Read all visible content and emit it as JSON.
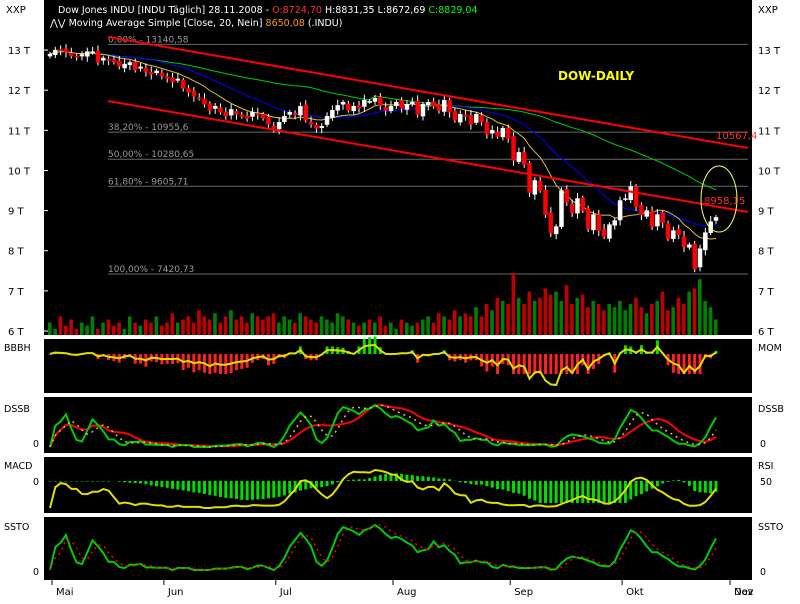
{
  "header": {
    "corner_left": "XXP",
    "corner_right": "XXP",
    "title_prefix": "Dow Jones INDU [INDU  Täglich] 28.11.2008 - ",
    "open_label": "O:8724,70",
    "high_low_label": " H:8831,35 L:8672,69 ",
    "close_label": "C:8829,04",
    "ma_legend_prefix": "Moving Average Simple [Close, 20, Nein] ",
    "ma_value": "8650,08",
    "ma_suffix": " (.INDU)"
  },
  "annotations": {
    "chart_title": "DOW-DAILY",
    "upper_channel_value": "10567,4",
    "lower_channel_value": "8958,15"
  },
  "fibonacci": [
    {
      "label": "0,00% - 13140,58",
      "value": 13140.58
    },
    {
      "label": "38,20% - 10955,6",
      "value": 10955.6
    },
    {
      "label": "50,00% - 10280,65",
      "value": 10280.65
    },
    {
      "label": "61,80% - 9605,71",
      "value": 9605.71
    },
    {
      "label": "100,00% - 7420,73",
      "value": 7420.73
    }
  ],
  "colors": {
    "background": "#000000",
    "up_candle": "#ffffff",
    "down_candle": "#ff0000",
    "ma20": "#e0c040",
    "ma50": "#0000ff",
    "ma200": "#00cc00",
    "trend_lines": "#ff0000",
    "title_text": "#ffff00",
    "volume_up": "#008000",
    "volume_down": "#c00000"
  },
  "panels": [
    {
      "label_left": "BBBH",
      "label_right": "MOM",
      "tick": ""
    },
    {
      "label_left": "DSSB",
      "label_right": "DSSB",
      "tick": "0"
    },
    {
      "label_left": "MACD",
      "label_right": "RSI",
      "tick_left": "0",
      "tick_right": "50"
    },
    {
      "label_left": "SSTO",
      "label_right": "SSTO",
      "tick": "0"
    }
  ],
  "chart_data": {
    "type": "candlestick",
    "title": "DOW-DAILY",
    "y_axis_ticks": [
      {
        "label": "13 T",
        "value": 13000
      },
      {
        "label": "12 T",
        "value": 12000
      },
      {
        "label": "11 T",
        "value": 11000
      },
      {
        "label": "10 T",
        "value": 10000
      },
      {
        "label": "9 T",
        "value": 9000
      },
      {
        "label": "8 T",
        "value": 8000
      },
      {
        "label": "7 T",
        "value": 7000
      },
      {
        "label": "6 T",
        "value": 6000
      }
    ],
    "ylim": [
      5900,
      13500
    ],
    "x_axis_months": [
      "Mai",
      "Jun",
      "Jul",
      "Aug",
      "Sep",
      "Okt",
      "Nov",
      "Dez"
    ],
    "closes": [
      12900,
      13000,
      12980,
      12950,
      12850,
      12820,
      12890,
      12960,
      12960,
      12700,
      12800,
      12760,
      12700,
      12600,
      12650,
      12690,
      12500,
      12580,
      12450,
      12400,
      12480,
      12350,
      12300,
      12200,
      12280,
      12050,
      11950,
      11850,
      11800,
      11650,
      11500,
      11600,
      11450,
      11350,
      11520,
      11400,
      11350,
      11300,
      11450,
      11400,
      11300,
      11150,
      11050,
      11200,
      11350,
      11450,
      11380,
      11600,
      11250,
      11150,
      11050,
      11100,
      11350,
      11500,
      11620,
      11700,
      11500,
      11600,
      11550,
      11750,
      11720,
      11800,
      11620,
      11500,
      11600,
      11700,
      11550,
      11650,
      11700,
      11400,
      11650,
      11700,
      11600,
      11500,
      11750,
      11450,
      11250,
      11400,
      11350,
      11150,
      11400,
      11200,
      10900,
      11000,
      10850,
      11050,
      10800,
      10250,
      10450,
      10150,
      9450,
      9750,
      9500,
      8900,
      8450,
      8600,
      9500,
      9200,
      8950,
      9300,
      9000,
      8550,
      8900,
      8500,
      8350,
      8650,
      8750,
      9250,
      9300,
      9600,
      9100,
      8900,
      9000,
      8600,
      8900,
      8700,
      8300,
      8500,
      8400,
      8100,
      8150,
      7550,
      8050,
      8450,
      8724,
      8829
    ],
    "volume_relative": [
      0.2,
      0.1,
      0.3,
      0.15,
      0.25,
      0.1,
      0.2,
      0.15,
      0.3,
      0.1,
      0.2,
      0.25,
      0.15,
      0.2,
      0.1,
      0.3,
      0.2,
      0.15,
      0.25,
      0.2,
      0.3,
      0.15,
      0.2,
      0.35,
      0.2,
      0.25,
      0.3,
      0.2,
      0.4,
      0.3,
      0.25,
      0.35,
      0.2,
      0.3,
      0.4,
      0.25,
      0.3,
      0.2,
      0.35,
      0.3,
      0.25,
      0.3,
      0.35,
      0.2,
      0.3,
      0.25,
      0.2,
      0.35,
      0.3,
      0.25,
      0.2,
      0.3,
      0.25,
      0.2,
      0.35,
      0.3,
      0.25,
      0.2,
      0.15,
      0.2,
      0.25,
      0.2,
      0.3,
      0.15,
      0.2,
      0.1,
      0.25,
      0.2,
      0.15,
      0.2,
      0.25,
      0.3,
      0.2,
      0.35,
      0.3,
      0.25,
      0.4,
      0.3,
      0.35,
      0.3,
      0.45,
      0.3,
      0.5,
      0.4,
      0.6,
      0.55,
      0.5,
      1.0,
      0.6,
      0.5,
      0.7,
      0.55,
      0.6,
      0.75,
      0.65,
      0.7,
      0.55,
      0.8,
      0.5,
      0.6,
      0.65,
      0.45,
      0.55,
      0.5,
      0.4,
      0.5,
      0.45,
      0.55,
      0.4,
      0.5,
      0.6,
      0.45,
      0.35,
      0.5,
      0.55,
      0.7,
      0.4,
      0.45,
      0.6,
      0.5,
      0.7,
      0.75,
      0.9,
      0.55,
      0.45,
      0.25
    ]
  }
}
